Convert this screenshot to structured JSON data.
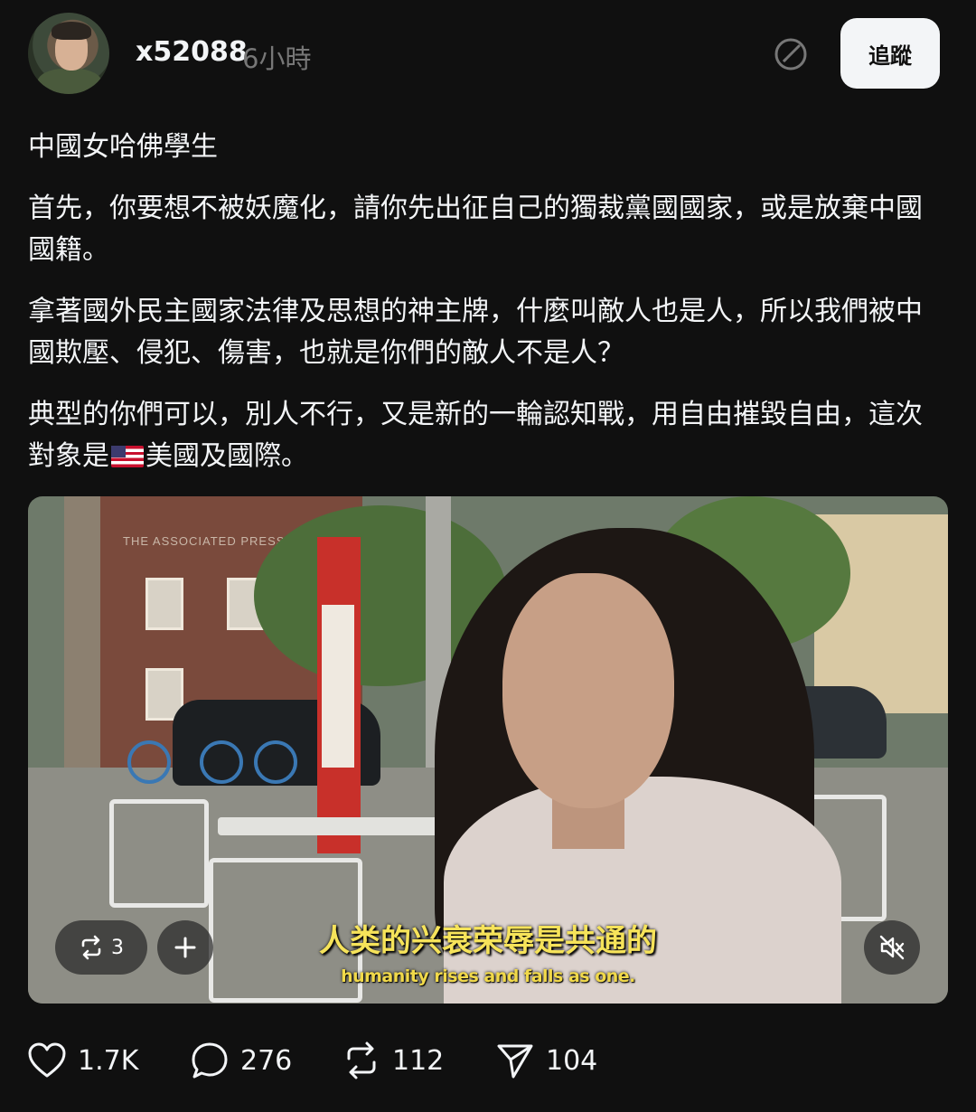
{
  "header": {
    "username": "x52088",
    "time": "6小時",
    "follow_label": "追蹤"
  },
  "post": {
    "p1": "中國女哈佛學生",
    "p2": "首先，你要想不被妖魔化，請你先出征自己的獨裁黨國國家，或是放棄中國國籍。",
    "p3": "拿著國外民主國家法律及思想的神主牌，什麼叫敵人也是人，所以我們被中國欺壓、侵犯、傷害，也就是你們的敵人不是人？",
    "p4_before_flag": "典型的你們可以，別人不行，又是新的一輪認知戰，用自由摧毀自由，這次對象是",
    "p4_after_flag": "美國及國際。"
  },
  "video": {
    "building_sign": "THE ASSOCIATED PRESS",
    "subtitle_zh": "人类的兴衰荣辱是共通的",
    "subtitle_en": "humanity rises and falls as one.",
    "repost_count": "3"
  },
  "actions": {
    "likes": "1.7K",
    "comments": "276",
    "reposts": "112",
    "shares": "104"
  },
  "icons": [
    "edit-icon",
    "repost-icon",
    "plus-icon",
    "mute-icon",
    "heart-icon",
    "comment-icon",
    "repost-icon",
    "send-icon"
  ],
  "colors": {
    "background": "#101010",
    "text": "#f3f5f7",
    "muted": "#777777",
    "follow_bg": "#f3f5f7",
    "subtitle": "#f6e35a"
  }
}
